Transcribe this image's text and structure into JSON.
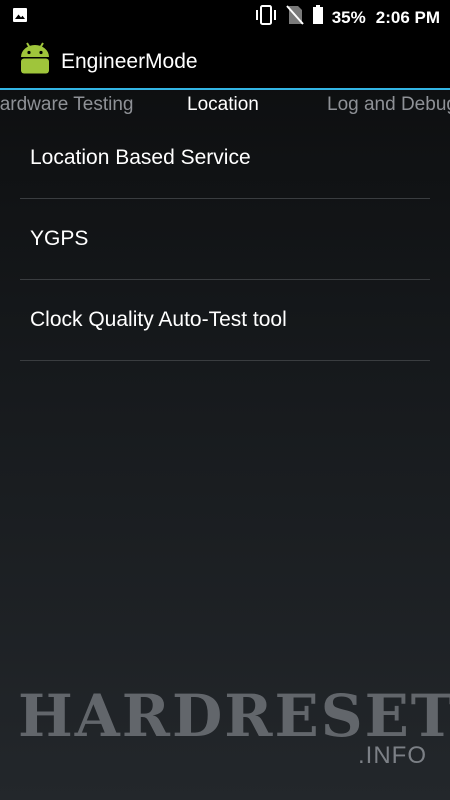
{
  "status_bar": {
    "battery_percent": "35%",
    "time": "2:06 PM",
    "icons": [
      "image-icon",
      "vibrate-icon",
      "no-sim-icon",
      "battery-icon"
    ]
  },
  "action_bar": {
    "title": "EngineerMode",
    "icon": "android-icon",
    "accent_color": "#33b5e5"
  },
  "tabs": {
    "left": "Hardware Testing",
    "center": "Location",
    "right": "Log and Debugging"
  },
  "list": {
    "items": [
      {
        "label": "Location Based Service"
      },
      {
        "label": "YGPS"
      },
      {
        "label": "Clock Quality Auto-Test tool"
      }
    ]
  },
  "watermark": {
    "main": "HARDRESET",
    "sub": ".INFO"
  }
}
